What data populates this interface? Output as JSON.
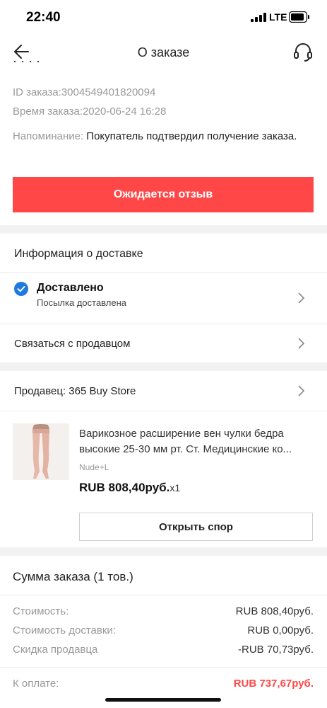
{
  "status_bar": {
    "time": "22:40",
    "network": "LTE"
  },
  "header": {
    "title": "О заказе"
  },
  "order": {
    "id_text": "ID заказа:3004549401820094",
    "time_text": "Время заказа:2020-06-24 16:28",
    "reminder_label": "Напоминание:",
    "reminder_text": " Покупатель подтвердил получение заказа."
  },
  "actions": {
    "review_button": "Ожидается отзыв",
    "dispute_button": "Открыть спор"
  },
  "delivery": {
    "section_title": "Информация о доставке",
    "status": "Доставлено",
    "status_detail": "Посылка доставлена",
    "contact_seller": "Связаться с продавцом"
  },
  "seller": {
    "label": "Продавец: 365 Buy Store"
  },
  "product": {
    "title": "Варикозное расширение вен чулки бедра высокие 25-30 мм рт. Ст. Медицинские ко...",
    "variant": "Nude+L",
    "price": "RUB 808,40руб.",
    "quantity": "x1"
  },
  "summary": {
    "title": "Сумма заказа (1 тов.)",
    "rows": [
      {
        "label": "Стоимость:",
        "value": "RUB 808,40руб."
      },
      {
        "label": "Стоимость доставки:",
        "value": "RUB 0,00руб."
      },
      {
        "label": "Скидка продавца",
        "value": "-RUB 70,73руб."
      },
      {
        "label": "К оплате:",
        "value": "RUB 737,67руб."
      }
    ]
  },
  "colors": {
    "accent": "#ff4747",
    "check_blue": "#1f7ae0",
    "separator": "#f2f2f2"
  },
  "icons": [
    "back-arrow-icon",
    "headset-icon",
    "check-circle-icon",
    "chevron-right-icon",
    "signal-icon",
    "battery-icon"
  ]
}
